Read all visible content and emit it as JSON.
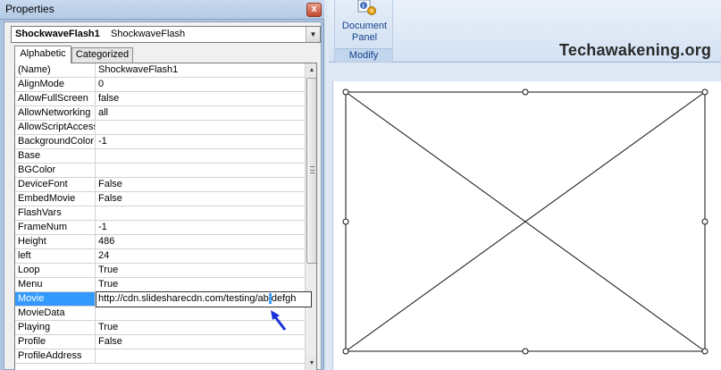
{
  "window": {
    "title": "Properties",
    "close_glyph": "x"
  },
  "object_selector": {
    "name": "ShockwaveFlash1",
    "type": "ShockwaveFlash"
  },
  "tabs": [
    {
      "label": "Alphabetic",
      "active": true
    },
    {
      "label": "Categorized",
      "active": false
    }
  ],
  "properties": [
    {
      "name": "(Name)",
      "value": "ShockwaveFlash1"
    },
    {
      "name": "AlignMode",
      "value": "0"
    },
    {
      "name": "AllowFullScreen",
      "value": "false"
    },
    {
      "name": "AllowNetworking",
      "value": "all"
    },
    {
      "name": "AllowScriptAccess",
      "value": ""
    },
    {
      "name": "BackgroundColor",
      "value": "-1"
    },
    {
      "name": "Base",
      "value": ""
    },
    {
      "name": "BGColor",
      "value": ""
    },
    {
      "name": "DeviceFont",
      "value": "False"
    },
    {
      "name": "EmbedMovie",
      "value": "False"
    },
    {
      "name": "FlashVars",
      "value": ""
    },
    {
      "name": "FrameNum",
      "value": "-1"
    },
    {
      "name": "Height",
      "value": "486"
    },
    {
      "name": "left",
      "value": "24"
    },
    {
      "name": "Loop",
      "value": "True"
    },
    {
      "name": "Menu",
      "value": "True"
    },
    {
      "name": "Movie",
      "value": ""
    },
    {
      "name": "MovieData",
      "value": ""
    },
    {
      "name": "Playing",
      "value": "True"
    },
    {
      "name": "Profile",
      "value": "False"
    },
    {
      "name": "ProfileAddress",
      "value": ""
    }
  ],
  "movie_edit": {
    "text_before": "http://cdn.slidesharecdn.com/testing/ab",
    "text_selected": ":",
    "text_after": "defgh"
  },
  "ribbon": {
    "button_label_line1": "Document",
    "button_label_line2": "Panel",
    "group_label": "Modify",
    "icon": "document-info-gear-icon"
  },
  "watermark": "Techawakening.org",
  "colors": {
    "selection": "#3399ff",
    "cursor": "#1a2fd6",
    "ribbon_text": "#15428b"
  }
}
